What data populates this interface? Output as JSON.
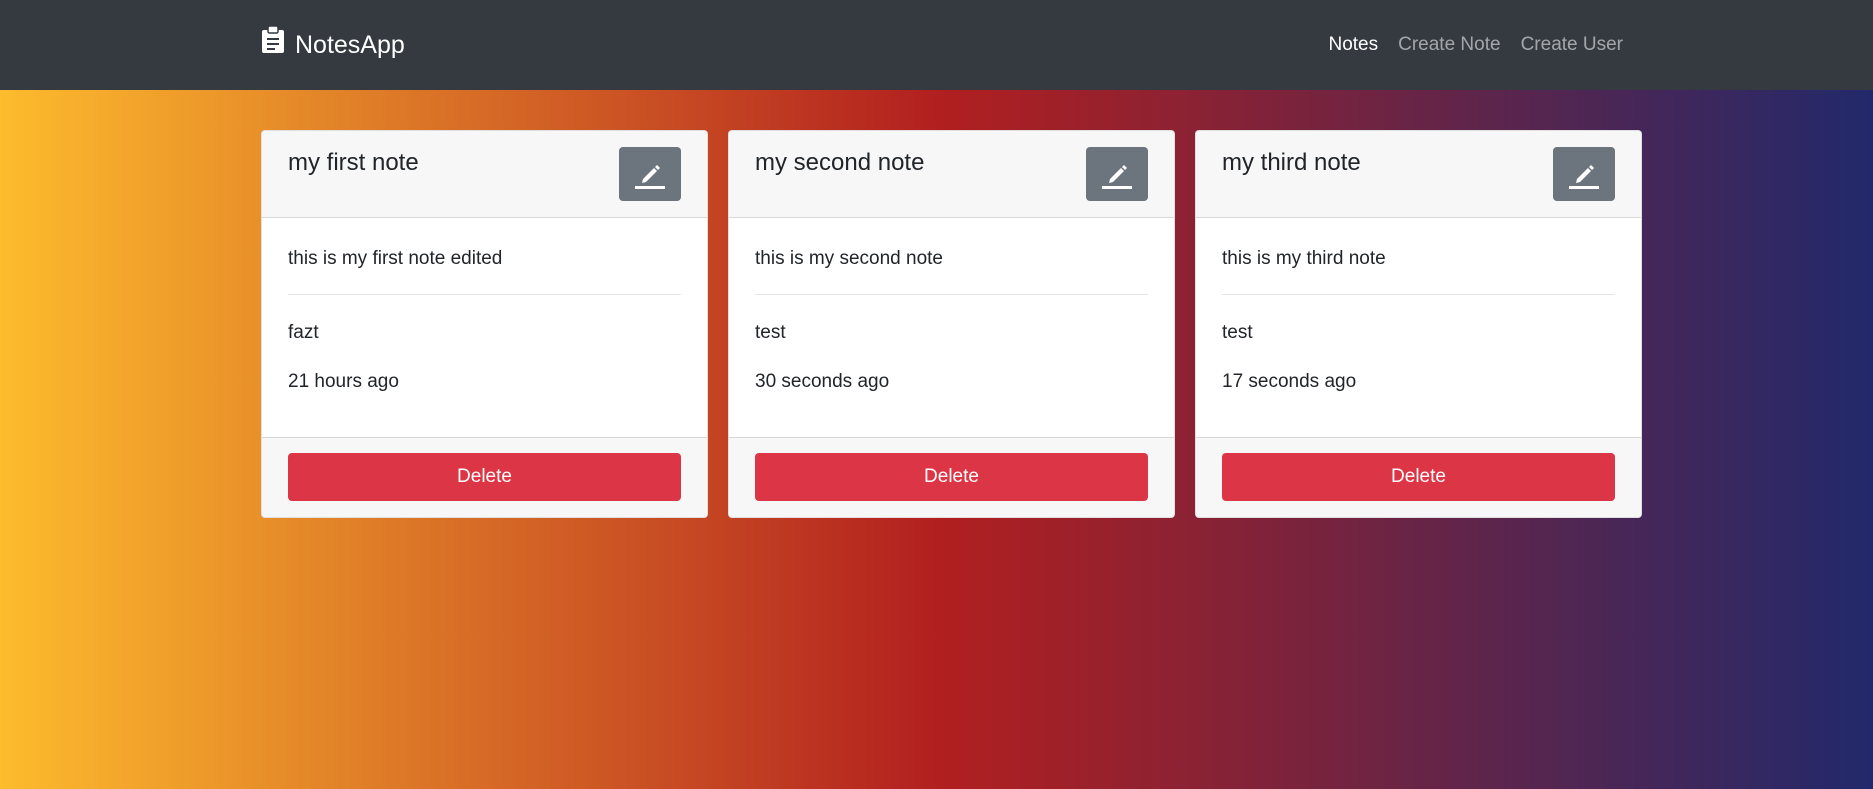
{
  "navbar": {
    "brand": "NotesApp",
    "brand_icon": "clipboard-icon",
    "links": [
      {
        "label": "Notes",
        "active": true
      },
      {
        "label": "Create Note",
        "active": false
      },
      {
        "label": "Create User",
        "active": false
      }
    ]
  },
  "colors": {
    "navbar_bg": "#343a40",
    "gradient": [
      "#fdbb2d",
      "#b21f1f",
      "#22296b"
    ],
    "delete": "#dc3545",
    "edit": "#6c757d"
  },
  "notes": [
    {
      "title": "my first note",
      "content": "this is my first note edited",
      "author": "fazt",
      "time": "21 hours ago",
      "edit_icon": "pencil-icon",
      "delete_label": "Delete"
    },
    {
      "title": "my second note",
      "content": "this is my second note",
      "author": "test",
      "time": "30 seconds ago",
      "edit_icon": "pencil-icon",
      "delete_label": "Delete"
    },
    {
      "title": "my third note",
      "content": "this is my third note",
      "author": "test",
      "time": "17 seconds ago",
      "edit_icon": "pencil-icon",
      "delete_label": "Delete"
    }
  ]
}
